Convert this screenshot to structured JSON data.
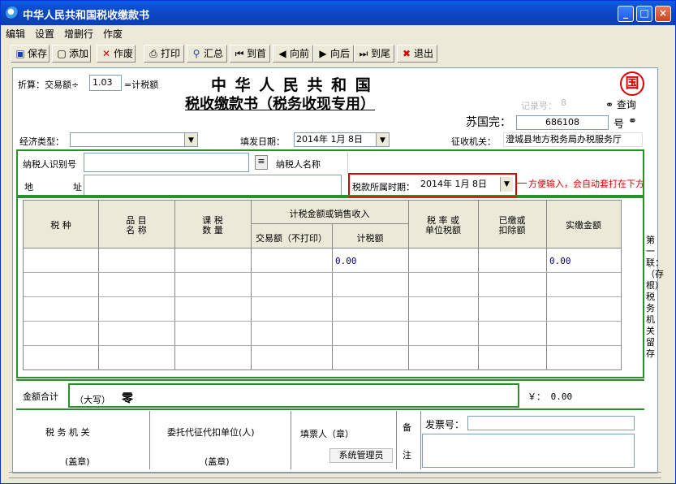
{
  "window": {
    "title": "中华人民共和国税收缴款书"
  },
  "menu": [
    "编辑",
    "设置",
    "增删行",
    "作废"
  ],
  "toolbar": {
    "save": "保存",
    "add": "添加",
    "void": "作废",
    "print": "打印",
    "summary": "汇总",
    "first": "到首",
    "prev": "向前",
    "next": "向后",
    "last": "到尾",
    "exit": "退出"
  },
  "form": {
    "conversion_prefix": "折算：交易额÷",
    "conversion_value": "1.03",
    "conversion_suffix": "=计税额",
    "title1": "中 华 人 民 共 和 国",
    "title2": "税收缴款书（税务收现专用）",
    "seal_char": "国",
    "record_label": "记录号：",
    "record_value": "8",
    "query": "查询",
    "series_label": "苏国完：",
    "series_value": "686108",
    "no_label": "号",
    "econ_type_label": "经济类型：",
    "econ_type_value": "",
    "fill_date_label": "填发日期：",
    "fill_date_value": "2014年 1月 8日",
    "collect_label": "征收机关：",
    "collect_value": "澄城县地方税务局办税服务厅",
    "taxpayer_id_label": "纳税人识别号",
    "taxpayer_name_label": "纳税人名称",
    "address_label1": "地",
    "address_label2": "址",
    "period_label": "税款所属时期：",
    "period_value": "2014年 1月 8日",
    "annotation": "方便输入，会自动套打在下方",
    "side_text": "第一联：（存根）税务机关留存",
    "total_label": "金额合计",
    "total_big_label": "（大写）",
    "total_big_value": "零",
    "total_small": "￥： 0.00",
    "footer_tax_office": "税 务 机 关",
    "footer_stamp1": "(盖章)",
    "footer_agent": "委托代征代扣单位(人)",
    "footer_stamp2": "(盖章)",
    "footer_filler": "填票人（章）",
    "footer_filler_value": "系统管理员",
    "footer_remark1": "备",
    "footer_remark2": "注",
    "invoice_label": "发票号："
  },
  "table": {
    "headers": {
      "tax_type": "税 种",
      "item_name1": "品 目",
      "item_name2": "名 称",
      "qty1": "课 税",
      "qty2": "数 量",
      "group": "计税金额或销售收入",
      "trade_amount": "交易额（不打印）",
      "tax_amount": "计税额",
      "rate1": "税 率 或",
      "rate2": "单位税额",
      "paid1": "已缴或",
      "paid2": "扣除额",
      "actual": "实缴金额"
    },
    "rows": [
      {
        "tax_amount": "0.00",
        "actual": "0.00"
      },
      {
        "tax_amount": "",
        "actual": ""
      },
      {
        "tax_amount": "",
        "actual": ""
      },
      {
        "tax_amount": "",
        "actual": ""
      },
      {
        "tax_amount": "",
        "actual": ""
      }
    ]
  }
}
